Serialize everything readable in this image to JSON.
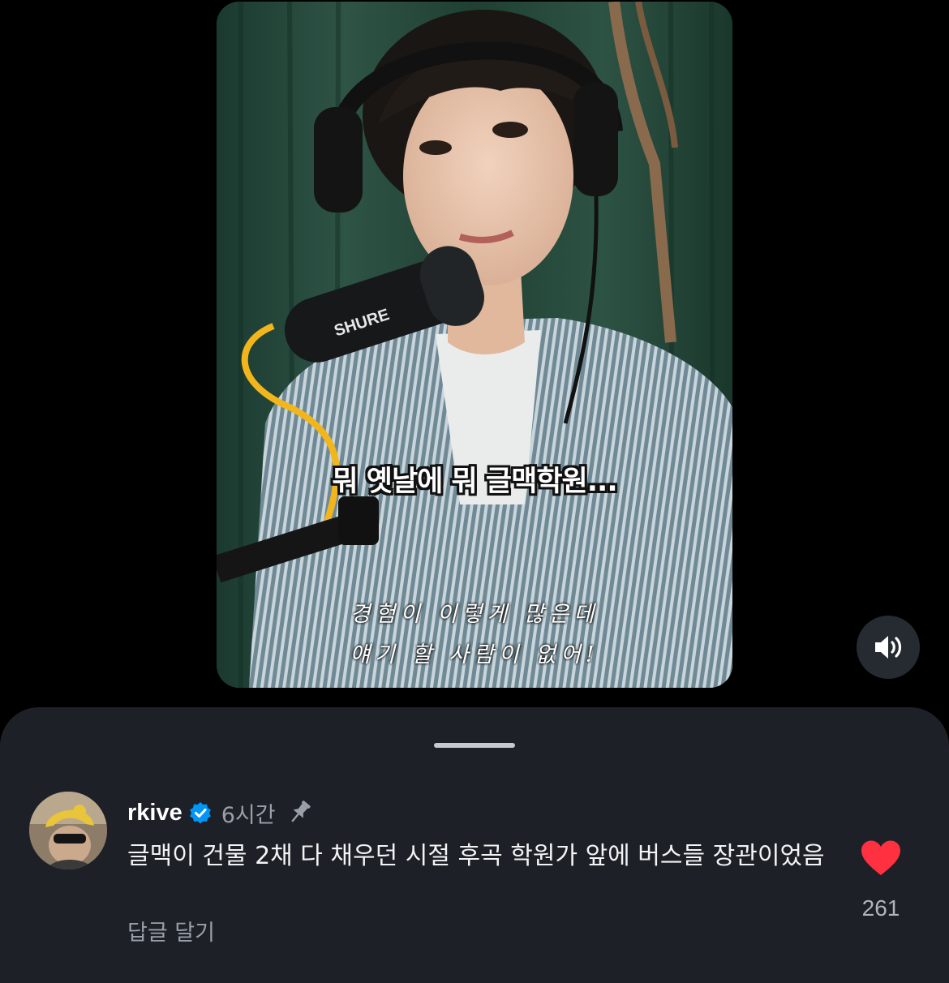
{
  "video": {
    "caption_main": "뭐 옛날에 뭐 글맥학원...",
    "caption_sub_line1": "경험이 이렇게 많은데",
    "caption_sub_line2": "얘기 할 사람이 없어!",
    "mic_brand": "SHURE",
    "sound_icon": "volume-on-icon"
  },
  "comment": {
    "username": "rkive",
    "verified_icon": "verified-badge-icon",
    "timestamp": "6시간",
    "pin_icon": "pin-icon",
    "text": "글맥이 건물 2채 다 채우던 시절 후곡 학원가 앞에 버스들 장관이었음",
    "reply_label": "답글 달기",
    "like_count": "261",
    "liked": true
  },
  "colors": {
    "heart": "#ff3040",
    "verified": "#0095f6",
    "sheet_bg": "#1d2026"
  }
}
